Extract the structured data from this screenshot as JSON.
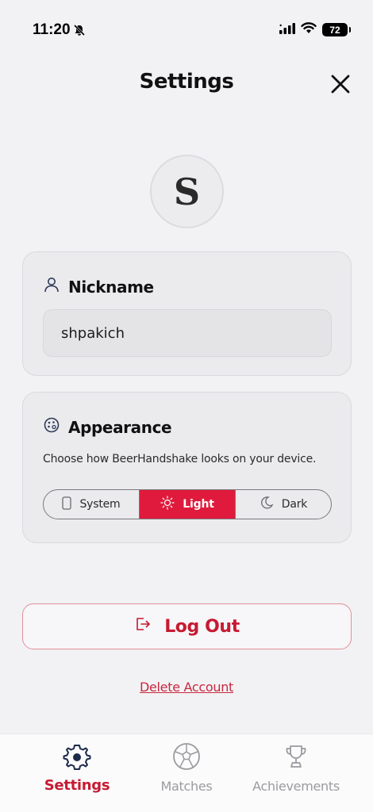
{
  "status_bar": {
    "time": "11:20",
    "battery": "72"
  },
  "header": {
    "title": "Settings"
  },
  "avatar": {
    "initial": "S"
  },
  "nickname": {
    "title": "Nickname",
    "value": "shpakich"
  },
  "appearance": {
    "title": "Appearance",
    "description": "Choose how BeerHandshake looks on your device.",
    "options": [
      "System",
      "Light",
      "Dark"
    ],
    "selected": "Light"
  },
  "actions": {
    "logout_label": "Log Out",
    "delete_label": "Delete Account"
  },
  "tabs": [
    {
      "label": "Settings",
      "icon": "gear-icon",
      "active": true
    },
    {
      "label": "Matches",
      "icon": "soccer-ball-icon",
      "active": false
    },
    {
      "label": "Achievements",
      "icon": "trophy-icon",
      "active": false
    }
  ],
  "colors": {
    "accent": "#e01a3c",
    "background": "#f2f2f4"
  }
}
